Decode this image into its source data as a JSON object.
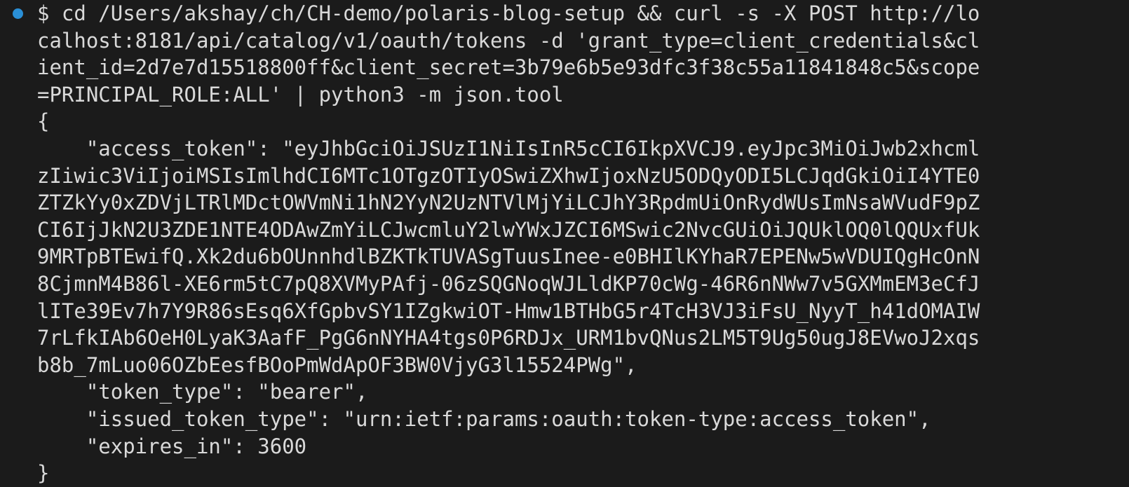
{
  "terminal": {
    "accent_dot_color": "#2a8fd6",
    "prompt_symbol": "$",
    "lines": [
      "$ cd /Users/akshay/ch/CH-demo/polaris-blog-setup && curl -s -X POST http://lo",
      "calhost:8181/api/catalog/v1/oauth/tokens -d 'grant_type=client_credentials&cl",
      "ient_id=2d7e7d15518800ff&client_secret=3b79e6b5e93dfc3f38c55a11841848c5&scope",
      "=PRINCIPAL_ROLE:ALL' | python3 -m json.tool",
      "{",
      "    \"access_token\": \"eyJhbGciOiJSUzI1NiIsInR5cCI6IkpXVCJ9.eyJpc3MiOiJwb2xhcml",
      "zIiwic3ViIjoiMSIsImlhdCI6MTc1OTgzOTIyOSwiZXhwIjoxNzU5ODQyODI5LCJqdGkiOiI4YTE0",
      "ZTZkYy0xZDVjLTRlMDctOWVmNi1hN2YyN2UzNTVlMjYiLCJhY3RpdmUiOnRydWUsImNsaWVudF9pZ",
      "CI6IjJkN2U3ZDE1NTE4ODAwZmYiLCJwcmluY2lwYWxJZCI6MSwic2NvcGUiOiJQUklOQ0lQQUxfUk",
      "9MRTpBTEwifQ.Xk2du6bOUnnhdlBZKTkTUVASgTuusInee-e0BHIlKYhaR7EPENw5wVDUIQgHcOnN",
      "8CjmnM4B86l-XE6rm5tC7pQ8XVMyPAfj-06zSQGNoqWJLldKP70cWg-46R6nNWw7v5GXMmEM3eCfJ",
      "lITe39Ev7h7Y9R86sEsq6XfGpbvSY1IZgkwiOT-Hmw1BTHbG5r4TcH3VJ3iFsU_NyyT_h41dOMAIW",
      "7rLfkIAb6OeH0LyaK3AafF_PgG6nNYHA4tgs0P6RDJx_URM1bvQNus2LM5T9Ug50ugJ8EVwoJ2xqs",
      "b8b_7mLuo06OZbEesfBOoPmWdApOF3BW0VjyG3l15524PWg\",",
      "    \"token_type\": \"bearer\",",
      "    \"issued_token_type\": \"urn:ietf:params:oauth:token-type:access_token\",",
      "    \"expires_in\": 3600",
      "}"
    ]
  }
}
